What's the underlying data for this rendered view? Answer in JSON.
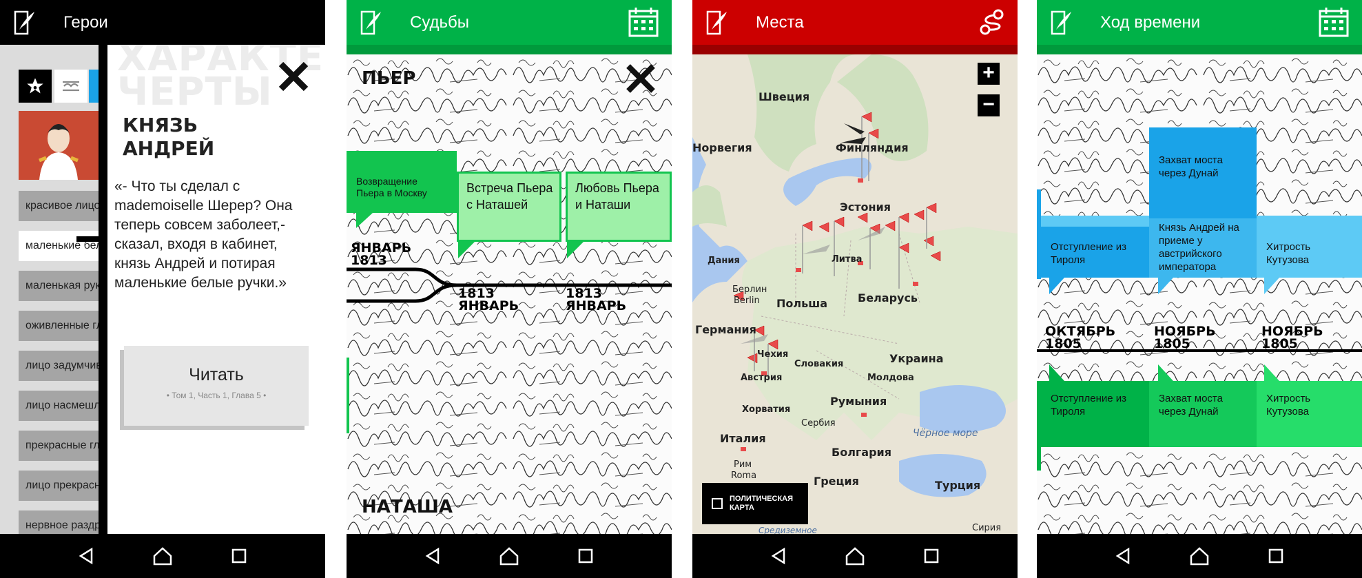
{
  "colors": {
    "black": "#000000",
    "green": "#00b248",
    "red": "#cc0000",
    "grey_item": "#a5a5a5",
    "calendar_green": "#5fd08a",
    "blue": "#1aa3e8",
    "light_blue": "#5dcaf5"
  },
  "screen1": {
    "title": "Герои",
    "bg_heading": "ХАРАКТЕР ЧЕРТЫ",
    "hero_name": "КНЯЗЬ АНДРЕЙ",
    "quote": "«- Что ты сделал с mademoiselle Шерер? Она теперь совсем заболеет,- сказал, входя в кабинет, князь Андрей и потирая маленькие белые ручки.»",
    "read_label": "Читать",
    "read_ref": "• Том 1, Часть 1, Глава 5 •",
    "traits": [
      "красивое лицо",
      "маленькие белые руки",
      "маленькая рука",
      "оживленные глаза",
      "лицо задумчиво",
      "лицо насмешливо",
      "прекрасные глаза",
      "лицо прекрасно",
      "нервное раздражение"
    ],
    "icons": {
      "star": "star-icon",
      "mustache": "mustache-icon",
      "close": "close-icon",
      "logo": "quill-logo-icon"
    }
  },
  "screen2": {
    "title": "Судьбы",
    "top_name": "ПЬЕР",
    "bottom_name": "НАТАША",
    "events": [
      {
        "text": "Возвращение Пьера в Москву"
      },
      {
        "text": "Встреча Пьера с Наташей"
      },
      {
        "text": "Любовь Пьера и Наташи"
      }
    ],
    "dates": [
      {
        "month": "ЯНВАРЬ",
        "year": "1813"
      },
      {
        "year": "1813",
        "month": "ЯНВАРЬ"
      },
      {
        "year": "1813",
        "month": "ЯНВАРЬ"
      }
    ],
    "icons": {
      "calendar": "calendar-icon",
      "close": "close-icon"
    }
  },
  "screen3": {
    "title": "Места",
    "countries": [
      "Швеция",
      "Финляндия",
      "Норвегия",
      "Эстония",
      "Дания",
      "Литва",
      "Berlin",
      "Берлин",
      "Польша",
      "Беларусь",
      "Германия",
      "Украина",
      "Чехия",
      "Словакия",
      "Австрия",
      "Молдова",
      "Хорватия",
      "Румыния",
      "Сербия",
      "Италия",
      "Болгария",
      "Рим",
      "Roma",
      "Греция",
      "Турция",
      "Чёрное море",
      "Сирия",
      "Средиземное"
    ],
    "political_map": "ПОЛИТИЧЕСКАЯ КАРТА",
    "zoom_in": "+",
    "zoom_out": "−",
    "icons": {
      "route": "route-icon"
    }
  },
  "screen4": {
    "title": "Ход времени",
    "top_events": [
      {
        "text": "Захват моста через Дунай"
      },
      {
        "text": "Отступление из Тироля"
      },
      {
        "text": "Князь Андрей на приеме у австрийского императора"
      },
      {
        "text": "Хитрость Кутузова"
      }
    ],
    "dates": [
      {
        "month": "ОКТЯБРЬ",
        "year": "1805"
      },
      {
        "month": "НОЯБРЬ",
        "year": "1805"
      },
      {
        "month": "НОЯБРЬ",
        "year": "1805"
      }
    ],
    "bottom_events": [
      {
        "text": "Отступление из Тироля"
      },
      {
        "text": "Захват моста через Дунай"
      },
      {
        "text": "Хитрость Кутузова"
      }
    ],
    "icons": {
      "calendar": "calendar-icon"
    }
  }
}
